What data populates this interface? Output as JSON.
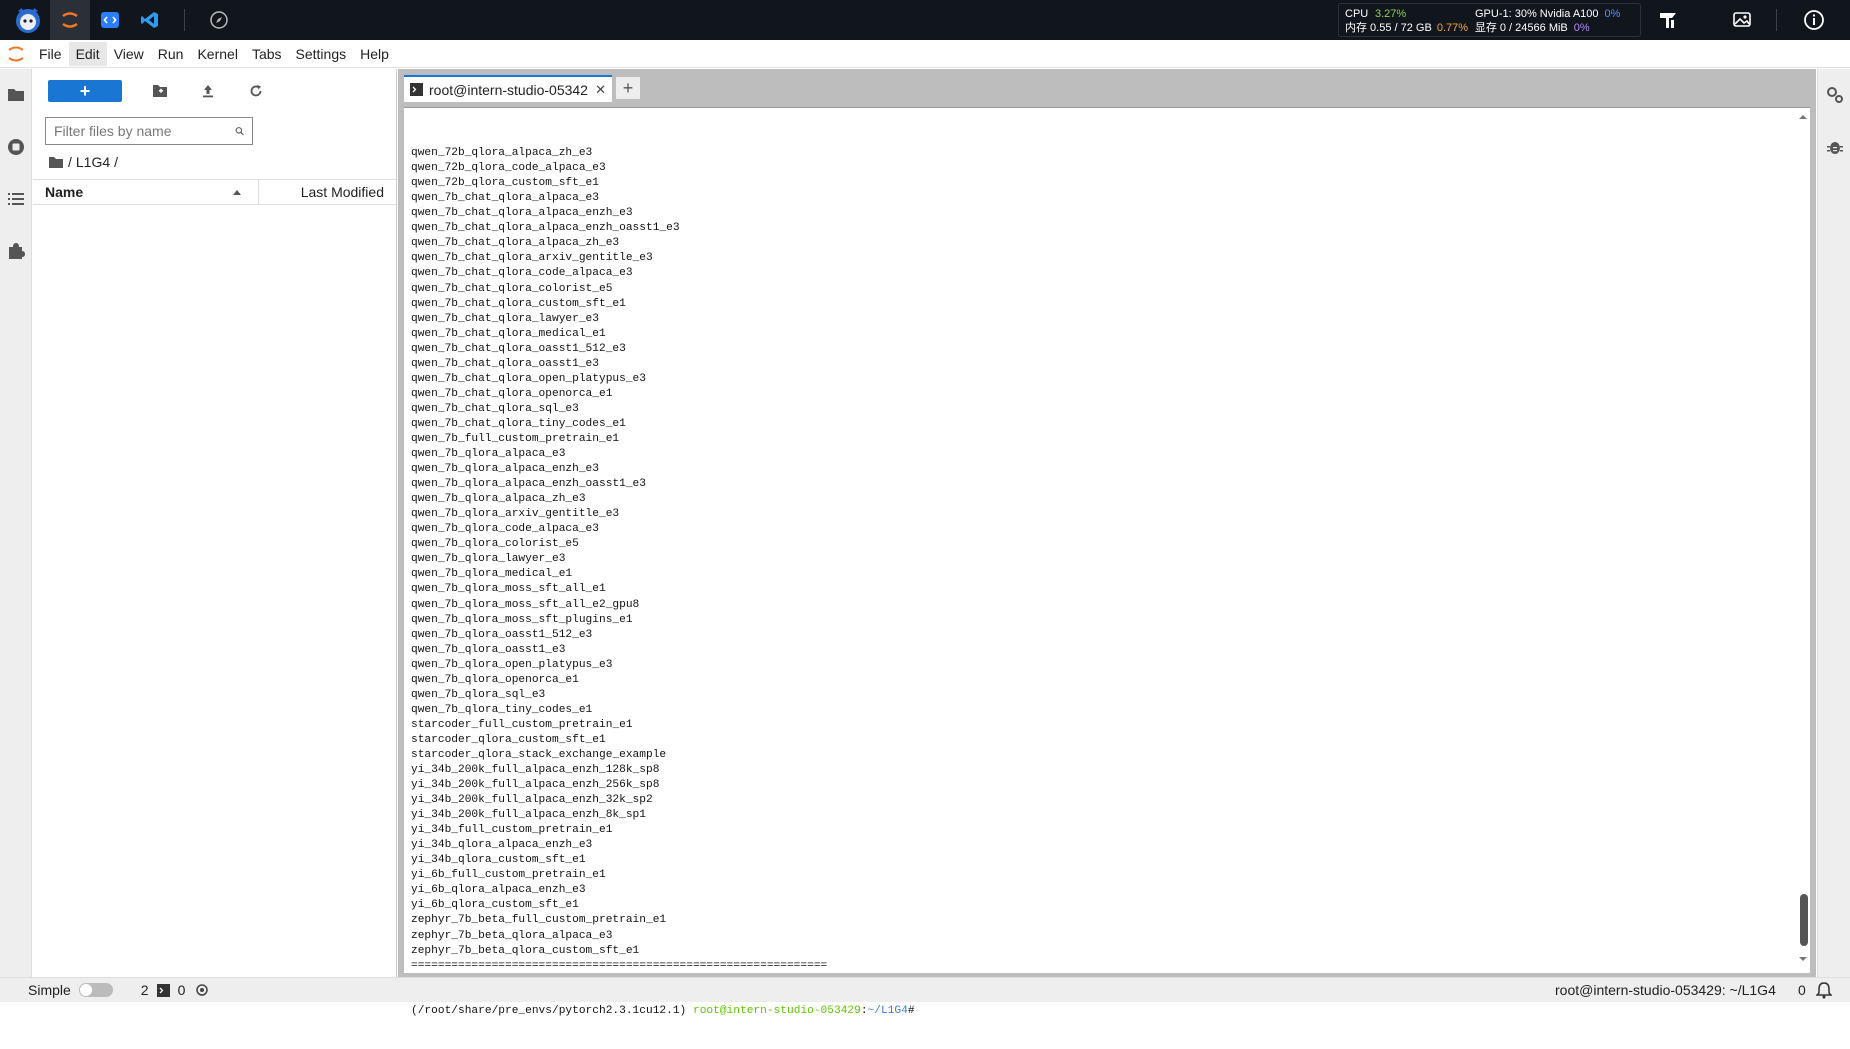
{
  "system_stats": {
    "cpu_label": "CPU",
    "cpu_value": "3.27%",
    "gpu_label": "GPU-1: 30% Nvidia A100",
    "gpu_value": "0%",
    "mem_label": "内存 0.55 / 72 GB",
    "mem_value": "0.77%",
    "vram_label": "显存 0 / 24566 MiB",
    "vram_value": "0%"
  },
  "menu": [
    "File",
    "Edit",
    "View",
    "Run",
    "Kernel",
    "Tabs",
    "Settings",
    "Help"
  ],
  "active_menu": "Edit",
  "file_browser": {
    "new_label": "+",
    "filter_placeholder": "Filter files by name",
    "breadcrumb_root": "/",
    "breadcrumb_folder": "L1G4",
    "breadcrumb_trailing": "/",
    "col_name": "Name",
    "col_modified": "Last Modified"
  },
  "tab": {
    "label": "root@intern-studio-05342",
    "close": "✕",
    "add": "+"
  },
  "terminal": {
    "lines": [
      "qwen_72b_qlora_alpaca_zh_e3",
      "qwen_72b_qlora_code_alpaca_e3",
      "qwen_72b_qlora_custom_sft_e1",
      "qwen_7b_chat_qlora_alpaca_e3",
      "qwen_7b_chat_qlora_alpaca_enzh_e3",
      "qwen_7b_chat_qlora_alpaca_enzh_oasst1_e3",
      "qwen_7b_chat_qlora_alpaca_zh_e3",
      "qwen_7b_chat_qlora_arxiv_gentitle_e3",
      "qwen_7b_chat_qlora_code_alpaca_e3",
      "qwen_7b_chat_qlora_colorist_e5",
      "qwen_7b_chat_qlora_custom_sft_e1",
      "qwen_7b_chat_qlora_lawyer_e3",
      "qwen_7b_chat_qlora_medical_e1",
      "qwen_7b_chat_qlora_oasst1_512_e3",
      "qwen_7b_chat_qlora_oasst1_e3",
      "qwen_7b_chat_qlora_open_platypus_e3",
      "qwen_7b_chat_qlora_openorca_e1",
      "qwen_7b_chat_qlora_sql_e3",
      "qwen_7b_chat_qlora_tiny_codes_e1",
      "qwen_7b_full_custom_pretrain_e1",
      "qwen_7b_qlora_alpaca_e3",
      "qwen_7b_qlora_alpaca_enzh_e3",
      "qwen_7b_qlora_alpaca_enzh_oasst1_e3",
      "qwen_7b_qlora_alpaca_zh_e3",
      "qwen_7b_qlora_arxiv_gentitle_e3",
      "qwen_7b_qlora_code_alpaca_e3",
      "qwen_7b_qlora_colorist_e5",
      "qwen_7b_qlora_lawyer_e3",
      "qwen_7b_qlora_medical_e1",
      "qwen_7b_qlora_moss_sft_all_e1",
      "qwen_7b_qlora_moss_sft_all_e2_gpu8",
      "qwen_7b_qlora_moss_sft_plugins_e1",
      "qwen_7b_qlora_oasst1_512_e3",
      "qwen_7b_qlora_oasst1_e3",
      "qwen_7b_qlora_open_platypus_e3",
      "qwen_7b_qlora_openorca_e1",
      "qwen_7b_qlora_sql_e3",
      "qwen_7b_qlora_tiny_codes_e1",
      "starcoder_full_custom_pretrain_e1",
      "starcoder_qlora_custom_sft_e1",
      "starcoder_qlora_stack_exchange_example",
      "yi_34b_200k_full_alpaca_enzh_128k_sp8",
      "yi_34b_200k_full_alpaca_enzh_256k_sp8",
      "yi_34b_200k_full_alpaca_enzh_32k_sp2",
      "yi_34b_200k_full_alpaca_enzh_8k_sp1",
      "yi_34b_full_custom_pretrain_e1",
      "yi_34b_qlora_alpaca_enzh_e3",
      "yi_34b_qlora_custom_sft_e1",
      "yi_6b_full_custom_pretrain_e1",
      "yi_6b_qlora_alpaca_enzh_e3",
      "yi_6b_qlora_custom_sft_e1",
      "zephyr_7b_beta_full_custom_pretrain_e1",
      "zephyr_7b_beta_qlora_alpaca_e3",
      "zephyr_7b_beta_qlora_custom_sft_e1",
      "=============================================================="
    ],
    "prompt_env": "(/root/share/pre_envs/pytorch2.3.1cu12.1)",
    "prompt_user": "root@intern-studio-053429",
    "prompt_colon": ":",
    "prompt_path": "~/L1G4",
    "prompt_symbol": "#"
  },
  "statusbar": {
    "mode_label": "Simple",
    "terminals_count": "2",
    "kernels_count": "0",
    "right_text": "root@intern-studio-053429: ~/L1G4",
    "notifications_count": "0"
  },
  "colors": {
    "accent": "#1976d2",
    "prompt_user": "#5ec400",
    "prompt_path": "#3d7bd9"
  }
}
